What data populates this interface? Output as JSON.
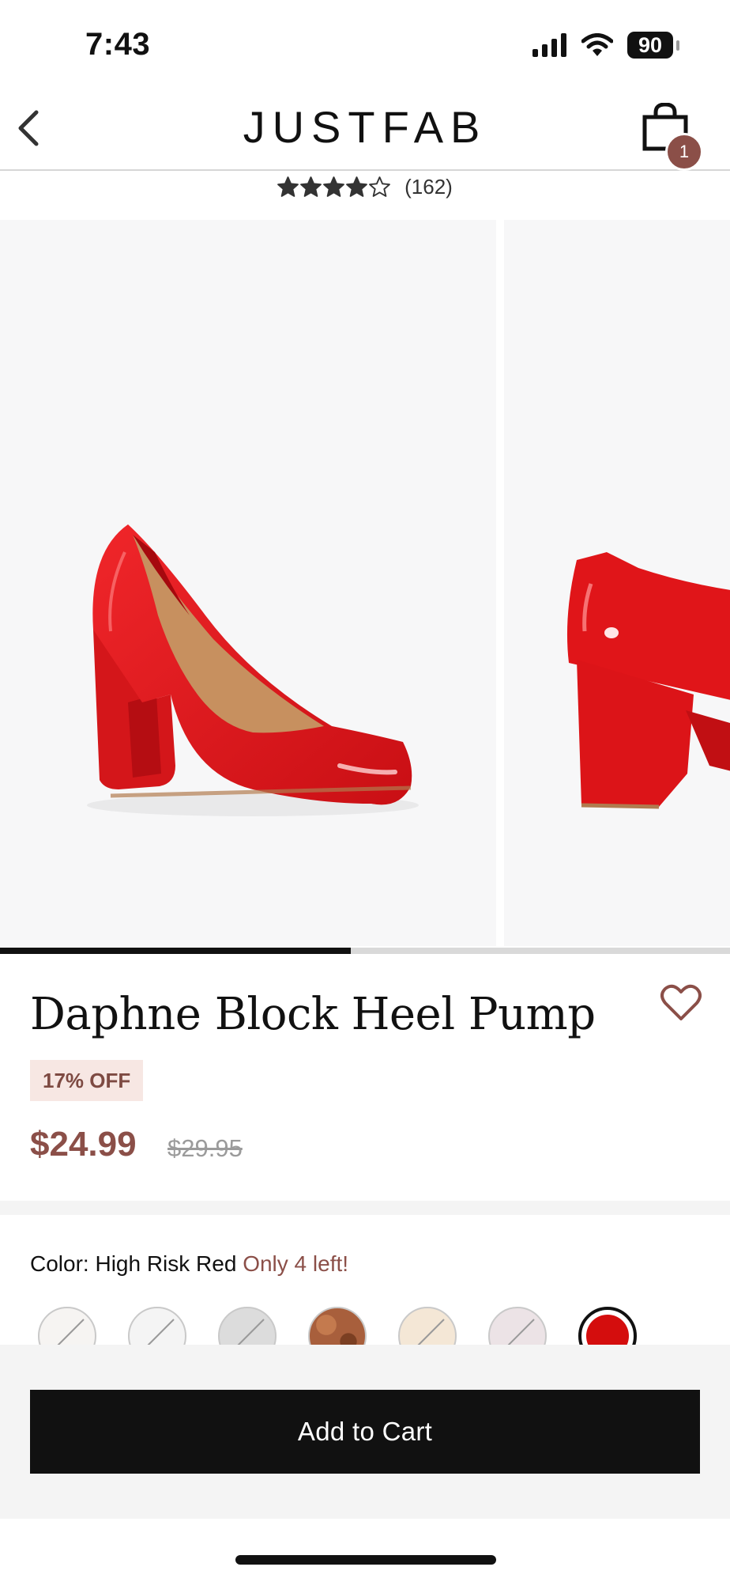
{
  "status_bar": {
    "time": "7:43",
    "battery": "90"
  },
  "header": {
    "logo": "JUSTFAB",
    "cart_count": "1"
  },
  "rating": {
    "stars": 4,
    "max_stars": 5,
    "review_count": "(162)"
  },
  "gallery": {
    "image_count": 2,
    "progress_fraction": 0.48
  },
  "product": {
    "title": "Daphne Block Heel Pump",
    "discount": "17% OFF",
    "sale_price": "$24.99",
    "original_price": "$29.95"
  },
  "color": {
    "label": "Color: High Risk Red",
    "stock_note": "Only 4 left!",
    "swatches": [
      {
        "name": "white",
        "color": "#f6f4f2",
        "sold_out": true
      },
      {
        "name": "white-patent",
        "color": "#f4f4f4",
        "sold_out": true
      },
      {
        "name": "silver",
        "color": "#dcdcdc",
        "sold_out": true
      },
      {
        "name": "brown-leopard",
        "color": "#a85f3c",
        "sold_out": false
      },
      {
        "name": "cream",
        "color": "#f4e7d6",
        "sold_out": true
      },
      {
        "name": "blush",
        "color": "#ece3e6",
        "sold_out": true
      },
      {
        "name": "high-risk-red",
        "color": "#d40d0d",
        "sold_out": false,
        "selected": true
      }
    ]
  },
  "cta": {
    "add_to_cart": "Add to Cart"
  },
  "colors": {
    "accent": "#8b4f48",
    "badge_bg": "#f7e7e3",
    "button": "#111111"
  }
}
